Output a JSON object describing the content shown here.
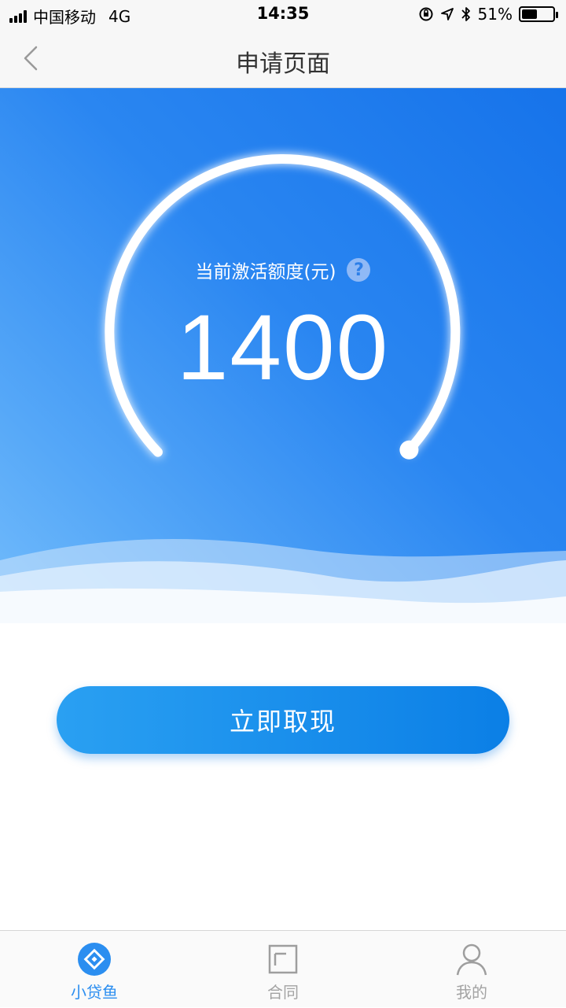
{
  "status_bar": {
    "carrier": "中国移动",
    "network": "4G",
    "time": "14:35",
    "battery": "51%",
    "battery_level": 0.51
  },
  "nav": {
    "title": "申请页面"
  },
  "gauge": {
    "label": "当前激活额度(元)",
    "help_glyph": "?",
    "value": "1400"
  },
  "actions": {
    "withdraw_label": "立即取现"
  },
  "tabs": [
    {
      "label": "小贷鱼",
      "icon": "diamond-icon",
      "active": true
    },
    {
      "label": "合同",
      "icon": "contract-icon",
      "active": false
    },
    {
      "label": "我的",
      "icon": "user-icon",
      "active": false
    }
  ],
  "colors": {
    "accent": "#2b8ef0",
    "hero_start": "#1673ea",
    "hero_end": "#73bcfb",
    "inactive": "#a3a3a3"
  }
}
